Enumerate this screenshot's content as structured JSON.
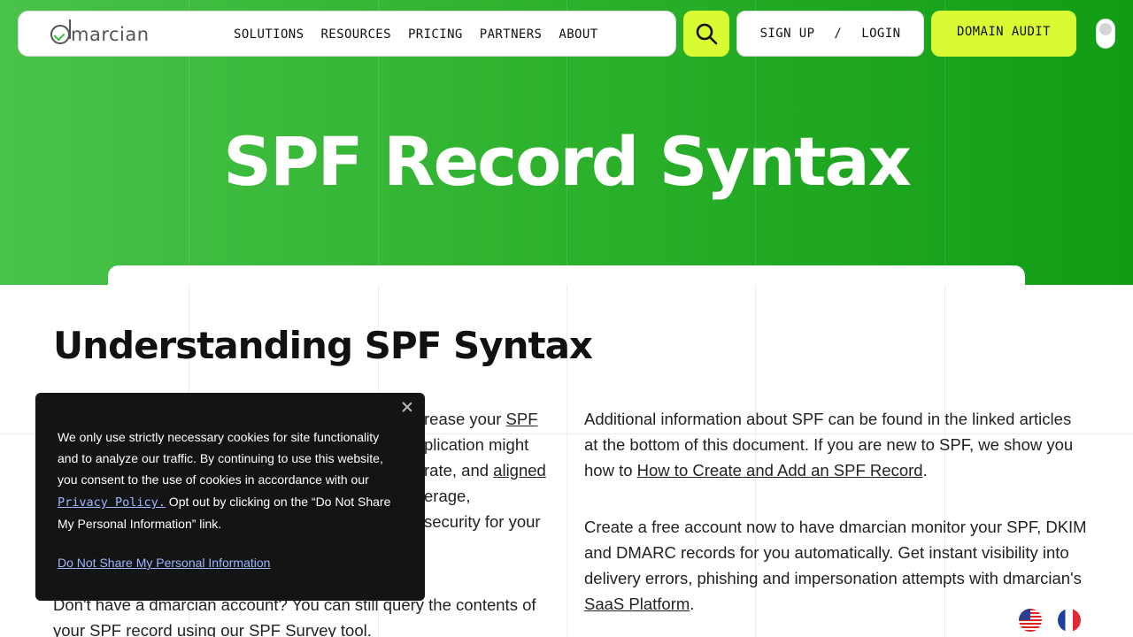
{
  "nav": {
    "logo_text": "marcian",
    "menu": [
      "SOLUTIONS",
      "RESOURCES",
      "PRICING",
      "PARTNERS",
      "ABOUT"
    ],
    "sign_up": "SIGN UP",
    "separator": "/",
    "login": "LOGIN",
    "domain_audit": "DOMAIN AUDIT"
  },
  "hero": {
    "title": "SPF Record Syntax"
  },
  "section": {
    "title": "Understanding SPF Syntax"
  },
  "left": {
    "p1_a": "rease your ",
    "p1_link_spf": "SPF",
    "p1_b": "plication might",
    "p1_c": "rate, and ",
    "p1_link_aligned": "aligned",
    "p1_d": "erage,",
    "p1_e": "security for your",
    "p2": "Don't have a dmarcian account? You can still query the contents of your SPF record using our SPF Survey tool."
  },
  "right": {
    "p1": "Additional information about SPF can be found in the linked articles at the bottom of this document. If you are new to SPF, we show you how to ",
    "p1_link": "How to Create and Add an SPF Record",
    "p1_end": ".",
    "p2": "Create a free account now to have dmarcian monitor your SPF, DKIM and DMARC records for you automatically.  Get instant visibility into delivery errors, phishing and impersonation attempts with dmarcian's ",
    "p2_link": "SaaS Platform",
    "p2_end": "."
  },
  "cookie": {
    "text_a": "We only use strictly necessary cookies for site functionality and to analyze our traffic. By continuing to use this website, you consent to the use of cookies in accordance with our",
    "policy_link": " Privacy Policy.",
    "text_b": " Opt out by clicking on the “Do Not Share My Personal Information” link.",
    "opt_out_link": "Do Not Share My Personal Information"
  },
  "colors": {
    "accent": "#d9fb34",
    "hero_green": "#2fb32f",
    "dark": "#141414"
  }
}
